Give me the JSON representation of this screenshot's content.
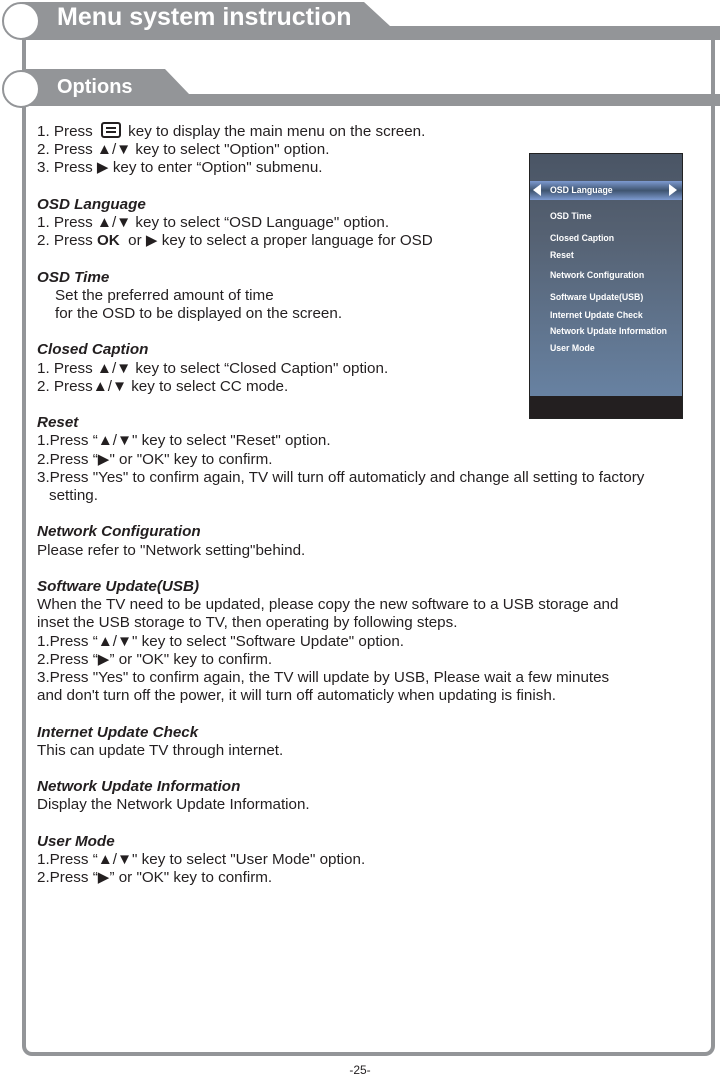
{
  "header": {
    "title": "Menu system instruction"
  },
  "section": {
    "title": "Options"
  },
  "intro": [
    {
      "before": "1. Press ",
      "icon": "menu-key-icon",
      "after": " key to display the main menu on the screen."
    },
    {
      "text": "2. Press ▲/▼ key to select \"Option\" option."
    },
    {
      "text": "3. Press ▶ key to enter “Option\" submenu."
    }
  ],
  "sections": {
    "osd_language": {
      "heading": "OSD Language",
      "line1": "1. Press ▲/▼ key to select “OSD Language\" option.",
      "line2_a": "2. Press ",
      "line2_ok": "OK",
      "line2_b": "  or ▶ key to select a proper language for OSD"
    },
    "osd_time": {
      "heading": "OSD Time",
      "line1": "Set the preferred amount of time",
      "line2": "for the OSD to be displayed on the screen."
    },
    "closed_caption": {
      "heading": "Closed Caption",
      "line1": "1. Press ▲/▼ key to select “Closed Caption\" option.",
      "line2": "2. Press▲/▼ key to select CC mode."
    },
    "reset": {
      "heading": "Reset",
      "line1": "1.Press “▲/▼\" key to select \"Reset\" option.",
      "line2": "2.Press “▶\" or \"OK\" key to confirm.",
      "line3": "3.Press \"Yes\" to confirm again, TV will turn off automaticly and change all setting to factory",
      "line4": "setting."
    },
    "network_configuration": {
      "heading": "Network Configuration",
      "line1": "Please refer to \"Network setting\"behind."
    },
    "software_update": {
      "heading": "Software Update(USB)",
      "line1": "When the TV need to be updated, please copy the new software to a USB storage and",
      "line2": "inset the USB storage to TV, then operating by following steps.",
      "line3": "1.Press “▲/▼\" key to select \"Software Update\" option.",
      "line4": "2.Press “▶” or \"OK\" key to confirm.",
      "line5": "3.Press \"Yes\" to confirm again, the TV will update by USB, Please wait a few minutes",
      "line6": "and don't turn off the power, it will turn off automaticly when updating is finish."
    },
    "internet_update_check": {
      "heading": "Internet Update Check",
      "line1": "This can update TV through internet."
    },
    "network_update_information": {
      "heading": "Network Update Information",
      "line1": "Display the Network Update Information."
    },
    "user_mode": {
      "heading": "User Mode",
      "line1": "1.Press “▲/▼\" key to select \"User Mode\" option.",
      "line2": "2.Press “▶” or \"OK\" key to confirm."
    }
  },
  "osd_menu": {
    "selected_index": 0,
    "items": [
      "OSD Language",
      "OSD Time",
      "Closed Caption",
      "Reset",
      "Network Configuration",
      "Software Update(USB)",
      "Internet Update Check",
      "Network Update Information",
      "User Mode"
    ]
  },
  "footer": {
    "page_number": "-25-"
  },
  "colors": {
    "frame_gray": "#939598",
    "menu_highlight": "#7d9ad0",
    "menu_bg_top": "#4a5565",
    "menu_bg_bottom": "#6a86a8"
  }
}
